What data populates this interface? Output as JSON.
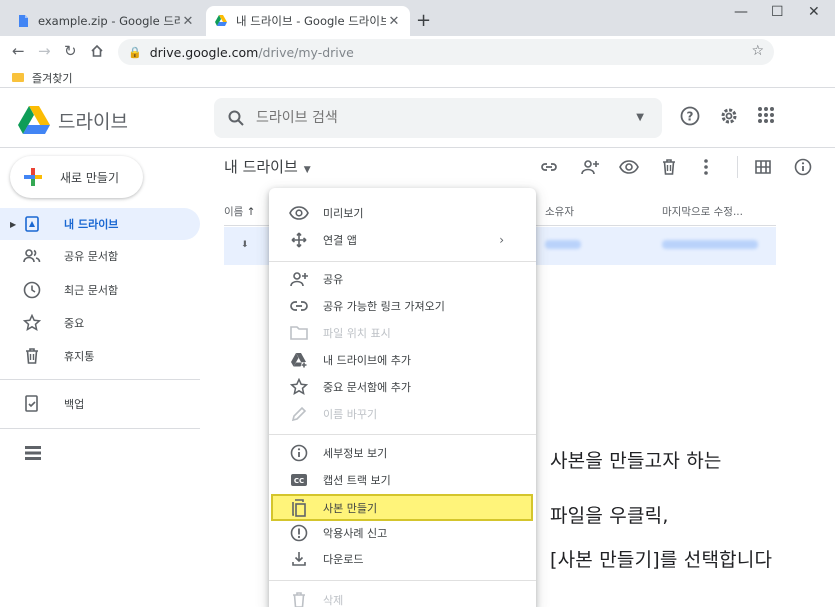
{
  "browser": {
    "tabs": [
      {
        "title": "example.zip - Google 드라이브",
        "active": false
      },
      {
        "title": "내 드라이브 - Google 드라이브",
        "active": true
      }
    ],
    "url_host": "drive.google.com",
    "url_path": "/drive/my-drive",
    "bookmarks_folder": "즐겨찾기"
  },
  "header": {
    "title": "드라이브",
    "search_placeholder": "드라이브 검색"
  },
  "sidebar": {
    "new_button": "새로 만들기",
    "items": [
      {
        "label": "내 드라이브",
        "icon": "my-drive-icon",
        "active": true
      },
      {
        "label": "공유 문서함",
        "icon": "shared-people-icon"
      },
      {
        "label": "최근 문서함",
        "icon": "clock-icon"
      },
      {
        "label": "중요",
        "icon": "star-icon"
      },
      {
        "label": "휴지통",
        "icon": "trash-icon"
      },
      {
        "label": "백업",
        "icon": "backup-icon"
      }
    ]
  },
  "content": {
    "breadcrumb": "내 드라이브",
    "columns": {
      "name": "이름",
      "owner": "소유자",
      "modified": "마지막으로 수정..."
    }
  },
  "context_menu": {
    "items": [
      {
        "label": "미리보기",
        "icon": "eye-icon"
      },
      {
        "label": "연결 앱",
        "icon": "move-arrows-icon",
        "submenu": true
      },
      {
        "label": "공유",
        "icon": "person-add-icon"
      },
      {
        "label": "공유 가능한 링크 가져오기",
        "icon": "link-icon"
      },
      {
        "label": "파일 위치 표시",
        "icon": "folder-icon",
        "disabled": true
      },
      {
        "label": "내 드라이브에 추가",
        "icon": "drive-add-icon"
      },
      {
        "label": "중요 문서함에 추가",
        "icon": "star-outline-icon"
      },
      {
        "label": "이름 바꾸기",
        "icon": "pencil-icon",
        "disabled": true
      },
      {
        "label": "세부정보 보기",
        "icon": "info-icon"
      },
      {
        "label": "캡션 트랙 보기",
        "icon": "cc-icon"
      },
      {
        "label": "사본 만들기",
        "icon": "copy-icon",
        "highlighted": true
      },
      {
        "label": "악용사례 신고",
        "icon": "report-icon"
      },
      {
        "label": "다운로드",
        "icon": "download-icon"
      },
      {
        "label": "삭제",
        "icon": "trash-icon",
        "disabled": true
      }
    ]
  },
  "annotation": {
    "line1": "사본을 만들고자 하는",
    "line2": "파일을 우클릭,",
    "line3": "[사본 만들기]를 선택합니다"
  },
  "colors": {
    "accent": "#1967d2",
    "active_bg": "#e8f0fe",
    "highlight": "#fff47a"
  }
}
